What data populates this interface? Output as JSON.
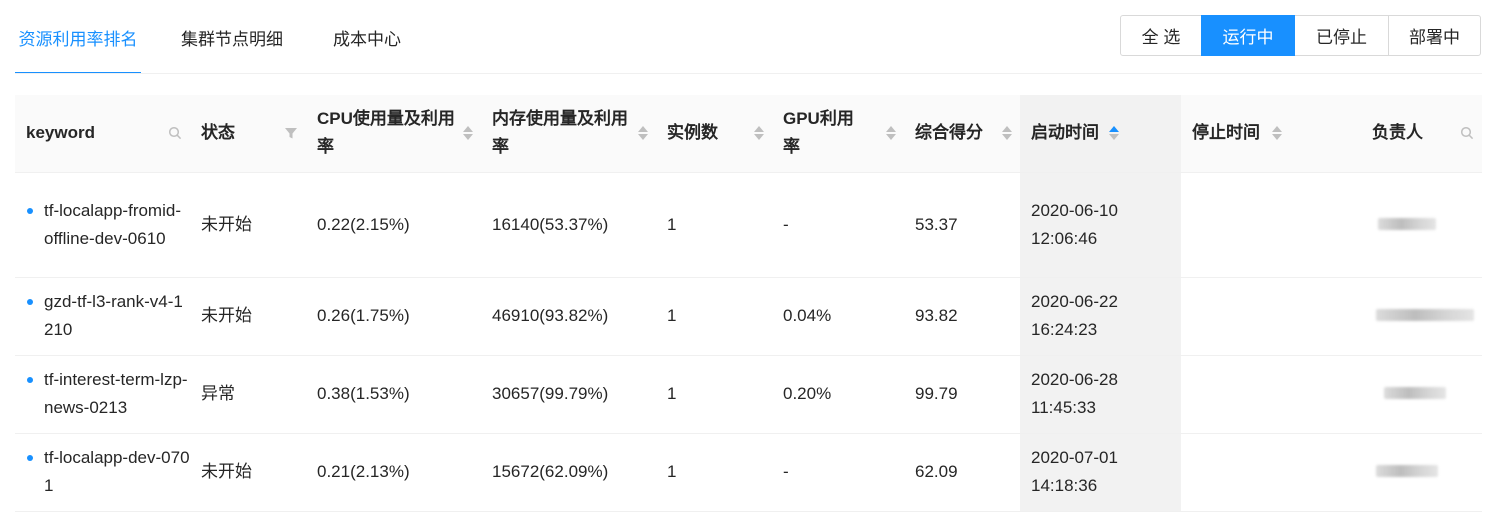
{
  "tabs": [
    {
      "label": "资源利用率排名",
      "active": true
    },
    {
      "label": "集群节点明细",
      "active": false
    },
    {
      "label": "成本中心",
      "active": false
    }
  ],
  "filters": [
    {
      "label": "全 选",
      "active": false
    },
    {
      "label": "运行中",
      "active": true
    },
    {
      "label": "已停止",
      "active": false
    },
    {
      "label": "部署中",
      "active": false
    }
  ],
  "table": {
    "columns": [
      {
        "label": "keyword",
        "icon": "search-icon"
      },
      {
        "label": "状态",
        "icon": "filter-icon"
      },
      {
        "label": "CPU使用量及利用率",
        "icon": "sort-icon"
      },
      {
        "label": "内存使用量及利用率",
        "icon": "sort-icon"
      },
      {
        "label": "实例数",
        "icon": "sort-icon"
      },
      {
        "label": "GPU利用率",
        "icon": "sort-icon"
      },
      {
        "label": "综合得分",
        "icon": "sort-icon"
      },
      {
        "label": "启动时间",
        "icon": "sort-asc-icon"
      },
      {
        "label": "停止时间",
        "icon": "sort-icon"
      },
      {
        "label": "负责人",
        "icon": "search-icon"
      }
    ],
    "rows": [
      {
        "keyword": "tf-localapp-fromid-offline-dev-0610",
        "status": "未开始",
        "cpu": "0.22(2.15%)",
        "memory": "16140(53.37%)",
        "instances": "1",
        "gpu": "-",
        "score": "53.37",
        "start_date": "2020-06-10",
        "start_time": "12:06:46",
        "stop": "",
        "owner": "(blurred)"
      },
      {
        "keyword": "gzd-tf-l3-rank-v4-1210",
        "status": "未开始",
        "cpu": "0.26(1.75%)",
        "memory": "46910(93.82%)",
        "instances": "1",
        "gpu": "0.04%",
        "score": "93.82",
        "start_date": "2020-06-22",
        "start_time": "16:24:23",
        "stop": "",
        "owner": "(blurred)"
      },
      {
        "keyword": "tf-interest-term-lzp-news-0213",
        "status": "异常",
        "cpu": "0.38(1.53%)",
        "memory": "30657(99.79%)",
        "instances": "1",
        "gpu": "0.20%",
        "score": "99.79",
        "start_date": "2020-06-28",
        "start_time": "11:45:33",
        "stop": "",
        "owner": "(blurred)"
      },
      {
        "keyword": "tf-localapp-dev-0701",
        "status": "未开始",
        "cpu": "0.21(2.13%)",
        "memory": "15672(62.09%)",
        "instances": "1",
        "gpu": "-",
        "score": "62.09",
        "start_date": "2020-07-01",
        "start_time": "14:18:36",
        "stop": "",
        "owner": "(blurred)"
      }
    ]
  },
  "colors": {
    "accent": "#1890ff",
    "header_bg": "#fafafa",
    "sorted_col_bg": "#f2f2f2",
    "border": "#f0f0f0"
  }
}
